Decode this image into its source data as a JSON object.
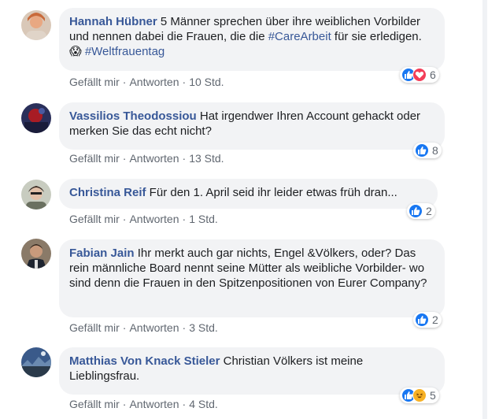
{
  "colors": {
    "author": "#385898",
    "hashtag": "#385898",
    "bubble_bg": "#f2f3f5",
    "meta": "#606770",
    "like": "#1877f2",
    "love": "#f33e58",
    "haha": "#f7b125"
  },
  "labels": {
    "like": "Gefällt mir",
    "reply": "Antworten",
    "separator": "·"
  },
  "comments": [
    {
      "author": "Hannah Hübner",
      "text_a": " 5 Männer sprechen über ihre weiblichen Vorbilder und nennen dabei die Frauen, die die ",
      "hashtag1": "#CareArbeit",
      "text_b": " für sie erledigen. ",
      "emoji": "😱",
      "hashtag2": "#Weltfrauentag",
      "time": "10 Std.",
      "reactions": [
        "like-icon",
        "love-icon"
      ],
      "reaction_count": "6"
    },
    {
      "author": "Vassilios Theodossiou",
      "text": " Hat irgendwer Ihren Account gehackt oder merken Sie das echt nicht?",
      "time": "13 Std.",
      "reactions": [
        "like-icon"
      ],
      "reaction_count": "8"
    },
    {
      "author": "Christina Reif",
      "text": " Für den 1. April seid ihr leider etwas früh dran...",
      "time": "1 Std.",
      "reactions": [
        "like-icon"
      ],
      "reaction_count": "2"
    },
    {
      "author": "Fabian Jain",
      "text": " Ihr merkt auch gar nichts, Engel &Völkers, oder? Das rein männliche Board nennt seine Mütter als weibliche Vorbilder- wo sind denn die Frauen in den Spitzenpositionen von Eurer Company?",
      "time": "3 Std.",
      "reactions": [
        "like-icon"
      ],
      "reaction_count": "2"
    },
    {
      "author": "Matthias Von Knack Stieler",
      "text": " Christian Völkers ist meine Lieblingsfrau.",
      "time": "4 Std.",
      "reactions": [
        "like-icon",
        "haha-icon"
      ],
      "reaction_count": "5"
    }
  ]
}
